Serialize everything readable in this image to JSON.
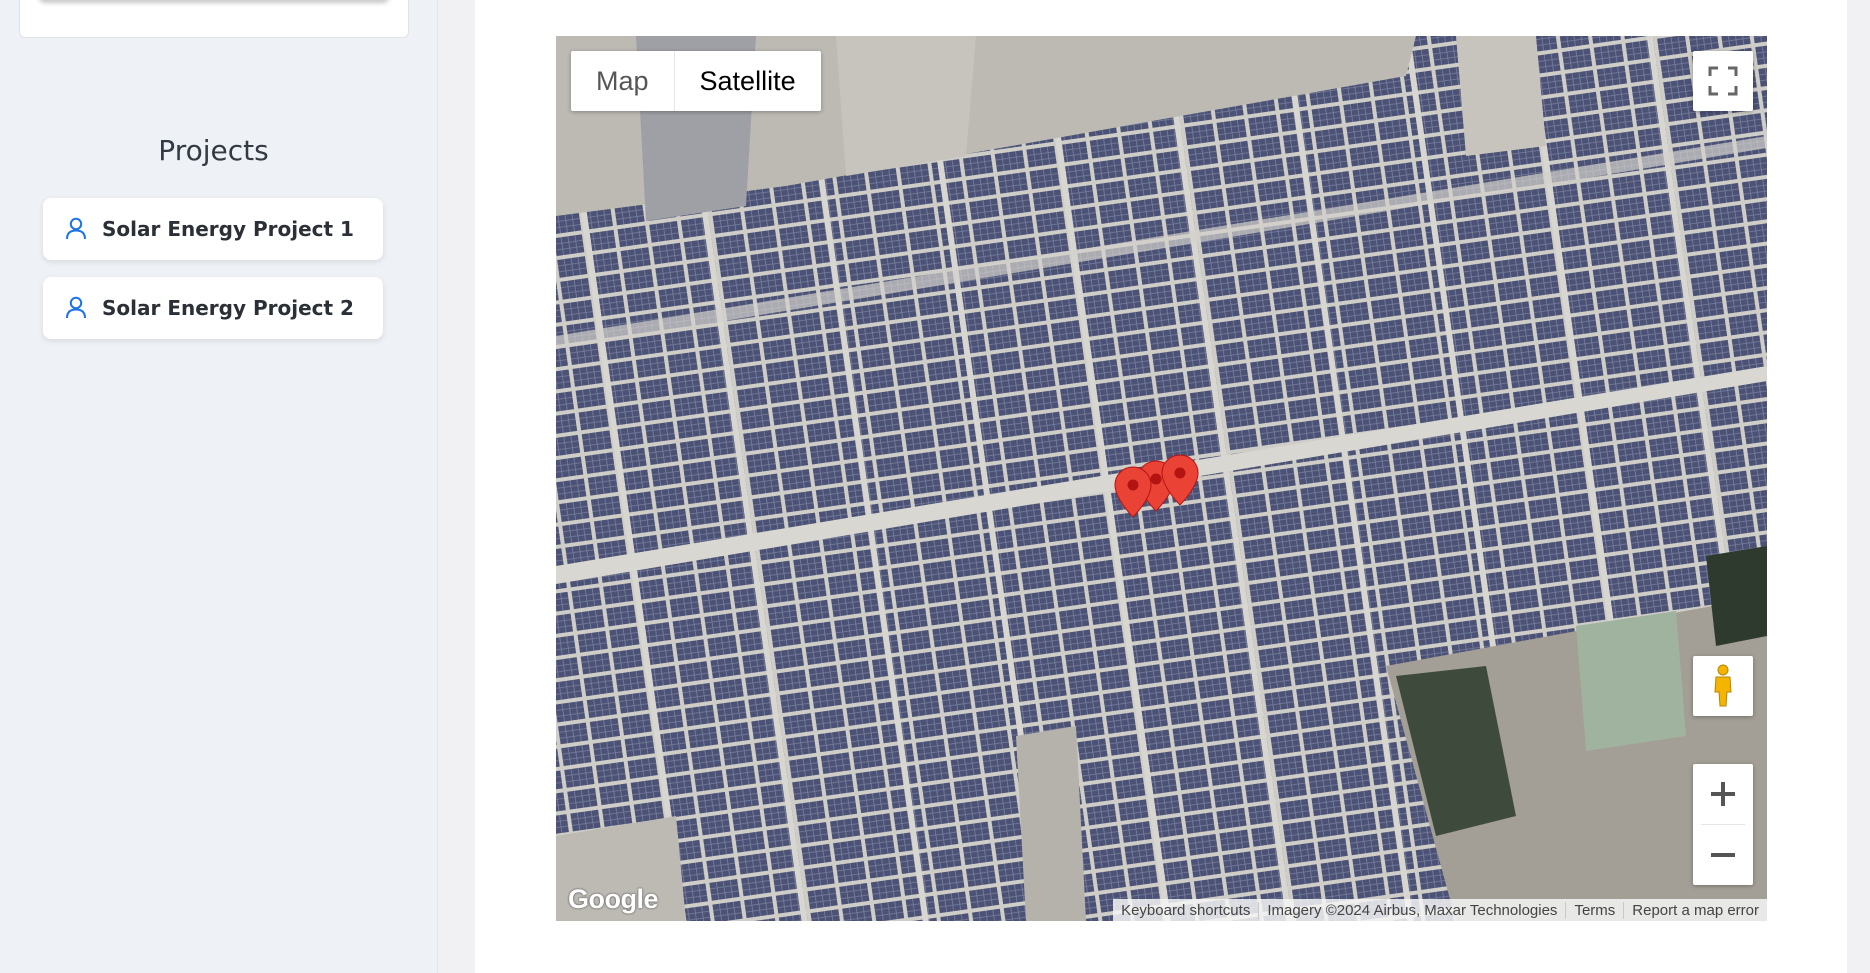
{
  "sidebar": {
    "title": "Projects",
    "projects": [
      {
        "label": "Solar Energy Project 1",
        "icon": "user-icon"
      },
      {
        "label": "Solar Energy Project 2",
        "icon": "user-icon"
      }
    ]
  },
  "map": {
    "type_control": {
      "map_label": "Map",
      "satellite_label": "Satellite",
      "selected": "Satellite"
    },
    "logo": "Google",
    "attribution": {
      "keyboard": "Keyboard shortcuts",
      "imagery": "Imagery ©2024 Airbus, Maxar Technologies",
      "terms": "Terms",
      "report": "Report a map error"
    },
    "markers": [
      {
        "icon": "map-pin-icon"
      },
      {
        "icon": "map-pin-icon"
      },
      {
        "icon": "map-pin-icon"
      }
    ],
    "colors": {
      "marker": "#ea4335",
      "panel": "#4a5070",
      "roof": "#c9c7c2",
      "pegman": "#f5b400"
    }
  }
}
